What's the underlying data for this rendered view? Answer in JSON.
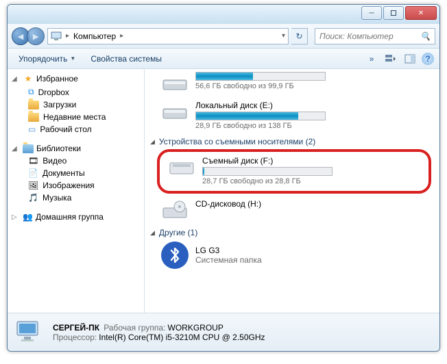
{
  "address": {
    "root": "Компьютер"
  },
  "search": {
    "placeholder": "Поиск: Компьютер"
  },
  "toolbar": {
    "organize": "Упорядочить",
    "props": "Свойства системы"
  },
  "side": {
    "fav": {
      "head": "Избранное",
      "items": [
        "Dropbox",
        "Загрузки",
        "Недавние места",
        "Рабочий стол"
      ]
    },
    "lib": {
      "head": "Библиотеки",
      "items": [
        "Видео",
        "Документы",
        "Изображения",
        "Музыка"
      ]
    },
    "home": {
      "head": "Домашняя группа"
    }
  },
  "main": {
    "drive0": {
      "free": "56,6 ГБ свободно из 99,9 ГБ"
    },
    "drive1": {
      "name": "Локальный диск (E:)",
      "free": "28,9 ГБ свободно из 138 ГБ"
    },
    "sec_rem": "Устройства со съемными носителями (2)",
    "drive2": {
      "name": "Съемный диск (F:)",
      "free": "28,7 ГБ свободно из 28,8 ГБ"
    },
    "drive3": {
      "name": "CD-дисковод (H:)"
    },
    "sec_other": "Другие (1)",
    "other": {
      "name": "LG G3",
      "sub": "Системная папка"
    }
  },
  "details": {
    "host": "СЕРГЕЙ-ПК",
    "wg_label": "Рабочая группа:",
    "wg": "WORKGROUP",
    "cpu_label": "Процессор:",
    "cpu": "Intel(R) Core(TM) i5-3210M CPU @ 2.50GHz"
  }
}
